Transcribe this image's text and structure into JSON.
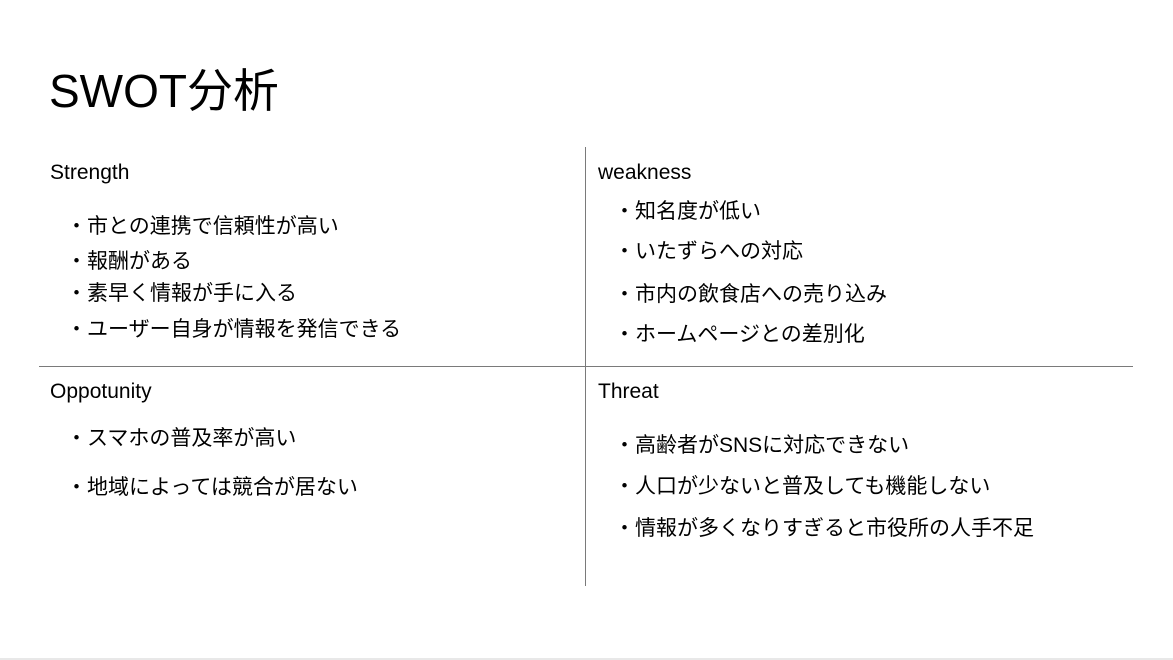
{
  "title": "SWOT分析",
  "strength": {
    "heading": "Strength",
    "items": [
      "・市との連携で信頼性が高い",
      "・報酬がある",
      "・素早く情報が手に入る",
      "・ユーザー自身が情報を発信できる"
    ]
  },
  "weakness": {
    "heading": "weakness",
    "items": [
      "・知名度が低い",
      "・いたずらへの対応",
      "・市内の飲食店への売り込み",
      "・ホームページとの差別化"
    ]
  },
  "opportunity": {
    "heading": "Oppotunity",
    "items": [
      "・スマホの普及率が高い",
      "・地域によっては競合が居ない"
    ]
  },
  "threat": {
    "heading": "Threat",
    "items": [
      "・高齢者がSNSに対応できない",
      "・人口が少ないと普及しても機能しない",
      "・情報が多くなりすぎると市役所の人手不足"
    ]
  }
}
